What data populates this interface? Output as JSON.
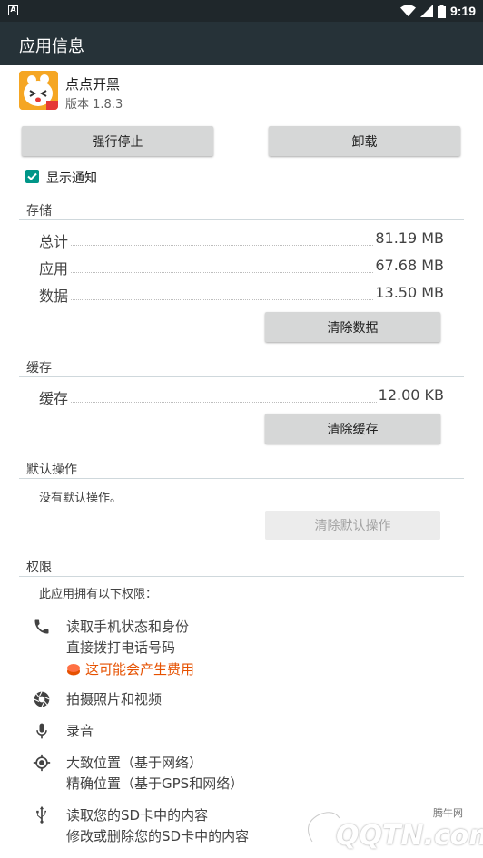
{
  "status_bar": {
    "time": "9:19",
    "notification_icon": "android-notification-icon",
    "wifi_icon": "wifi-icon",
    "signal_icon": "cell-signal-icon",
    "battery_icon": "battery-icon"
  },
  "app_bar": {
    "title": "应用信息"
  },
  "app": {
    "name": "点点开黑",
    "version": "版本 1.8.3"
  },
  "buttons": {
    "force_stop": "强行停止",
    "uninstall": "卸载"
  },
  "show_notifications": {
    "label": "显示通知",
    "checked": true
  },
  "storage": {
    "title": "存储",
    "rows": [
      {
        "label": "总计",
        "value": "81.19 MB"
      },
      {
        "label": "应用",
        "value": "67.68 MB"
      },
      {
        "label": "数据",
        "value": "13.50 MB"
      }
    ],
    "clear_button": "清除数据"
  },
  "cache": {
    "title": "缓存",
    "rows": [
      {
        "label": "缓存",
        "value": "12.00 KB"
      }
    ],
    "clear_button": "清除缓存"
  },
  "defaults": {
    "title": "默认操作",
    "text": "没有默认操作。",
    "clear_button": "清除默认操作"
  },
  "permissions": {
    "title": "权限",
    "intro": "此应用拥有以下权限：",
    "groups": [
      {
        "icon": "phone-icon",
        "lines": [
          "读取手机状态和身份",
          "直接拨打电话号码"
        ],
        "warning": "这可能会产生费用"
      },
      {
        "icon": "camera-icon",
        "lines": [
          "拍摄照片和视频"
        ]
      },
      {
        "icon": "microphone-icon",
        "lines": [
          "录音"
        ]
      },
      {
        "icon": "location-icon",
        "lines": [
          "大致位置（基于网络）",
          "精确位置（基于GPS和网络）"
        ]
      },
      {
        "icon": "usb-icon",
        "lines": [
          "读取您的SD卡中的内容",
          "修改或删除您的SD卡中的内容"
        ]
      }
    ]
  },
  "watermark": {
    "text": "QQTN.com",
    "label": "腾牛网"
  },
  "colors": {
    "accent": "#009688",
    "app_bar": "#263238",
    "status_bar": "#1f272b",
    "warning": "#e65100"
  }
}
